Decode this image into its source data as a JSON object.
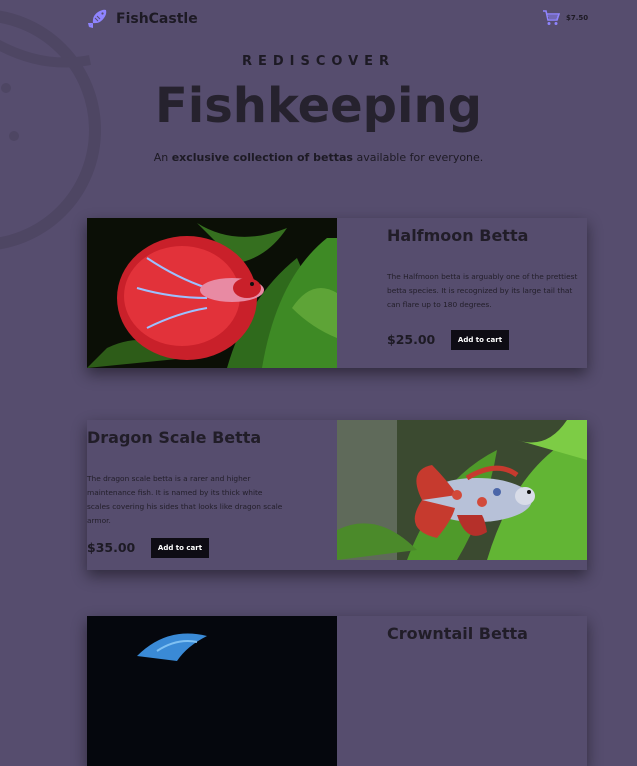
{
  "theme": {
    "background": "#564d6e",
    "accent": "#8f84ff",
    "button": "#0e0c14"
  },
  "nav": {
    "brand": "FishCastle",
    "logo_icon": "fish-icon",
    "cart_icon": "shopping-cart-icon",
    "cart_total": "$7.50"
  },
  "hero": {
    "kicker": "REDISCOVER",
    "title": "Fishkeeping",
    "subtitle_prefix": "An ",
    "subtitle_bold": "exclusive collection of bettas",
    "subtitle_suffix": " available for everyone."
  },
  "products": [
    {
      "name": "Halfmoon Betta",
      "description": "The Halfmoon betta is arguably one of the prettiest betta species. It is recognized by its large tail that can flare up to 180 degrees.",
      "price": "$25.00",
      "button": "Add to cart"
    },
    {
      "name": "Dragon Scale Betta",
      "description": "The dragon scale betta is a rarer and higher maintenance fish. It is named by its thick white scales covering his sides that looks like dragon scale armor.",
      "price": "$35.00",
      "button": "Add to cart"
    },
    {
      "name": "Crowntail Betta"
    }
  ]
}
